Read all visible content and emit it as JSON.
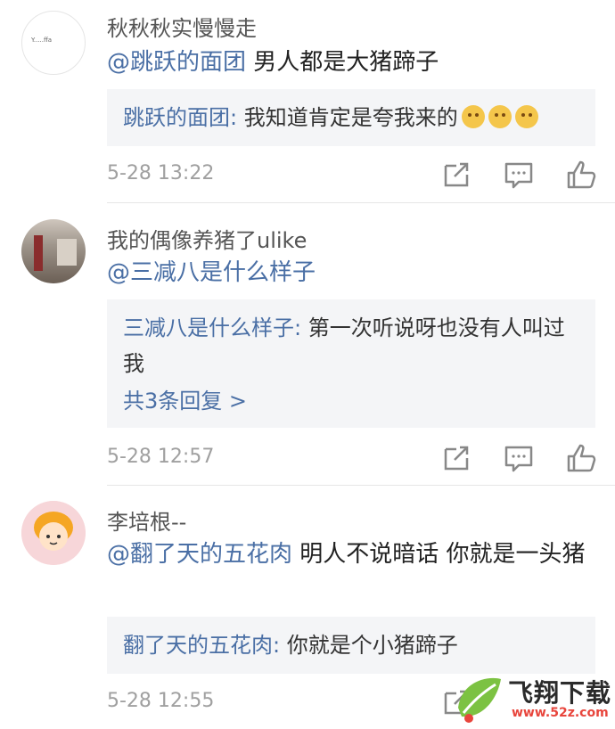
{
  "comments": [
    {
      "username": "秋秋秋实慢慢走",
      "avatar_text": "Y.....ffa",
      "mention": "@跳跃的面团",
      "text": " 男人都是大猪蹄子",
      "reply": {
        "author": "跳跃的面团:",
        "text": " 我知道肯定是夸我来的",
        "emojis": [
          "cat-laugh-emoji",
          "cat-laugh-emoji",
          "cat-laugh-emoji"
        ]
      },
      "time": "5-28 13:22"
    },
    {
      "username": "我的偶像养猪了ulike",
      "mention": "@三减八是什么样子",
      "text": "",
      "reply": {
        "author": "三减八是什么样子:",
        "text": " 第一次听说呀也没有人叫过我",
        "more": "共3条回复 >"
      },
      "time": "5-28 12:57"
    },
    {
      "username": "李培根--",
      "mention": "@翻了天的五花肉",
      "text": " 明人不说暗话 你就是一头猪",
      "reply": {
        "author": "翻了天的五花肉:",
        "text": " 你就是个小猪蹄子"
      },
      "time": "5-28 12:55"
    }
  ],
  "icons": [
    "forward-icon",
    "comment-icon",
    "like-icon"
  ],
  "watermark": {
    "title": "飞翔下载",
    "url": "www.52z.com"
  },
  "colors": {
    "mention": "#4a6fa5",
    "reply_bg": "#f4f5f7",
    "meta": "#a0a0a0"
  }
}
